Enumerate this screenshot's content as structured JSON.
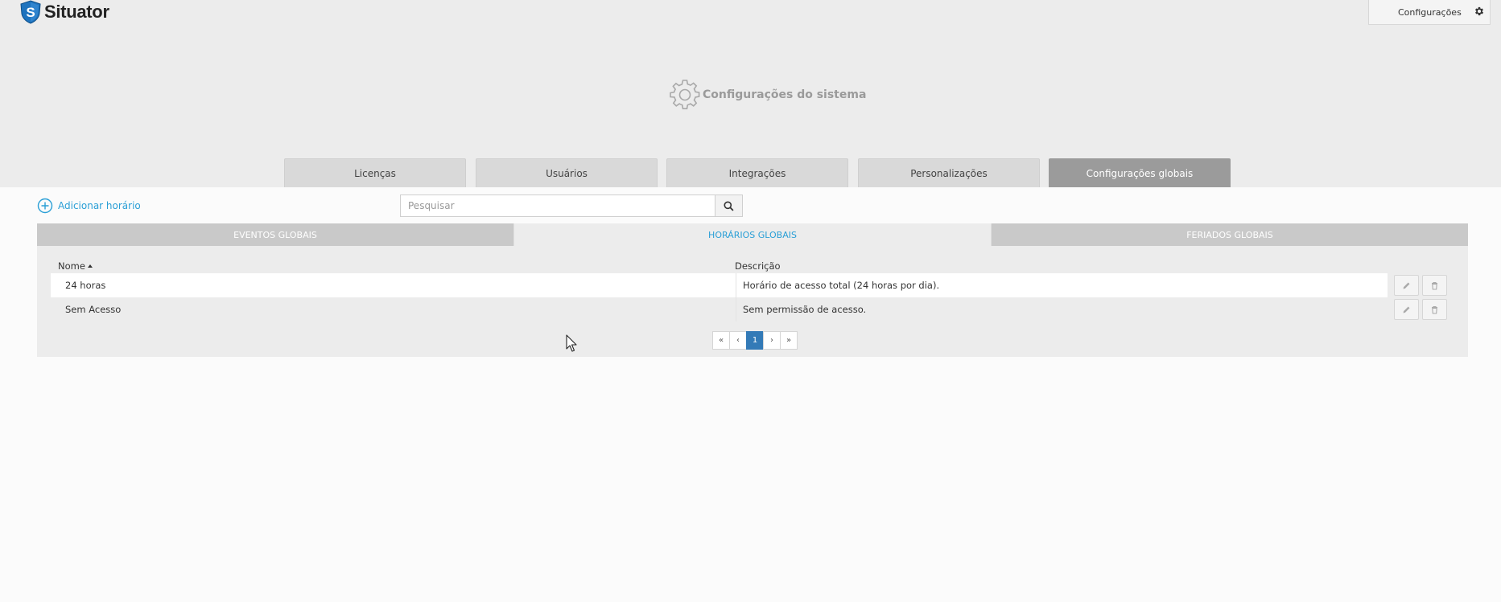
{
  "app": {
    "brand": "Situator"
  },
  "topbar": {
    "config_label": "Configurações",
    "config_icon": "gear-icon"
  },
  "page": {
    "title": "Configurações do sistema",
    "title_icon": "gear-icon"
  },
  "main_tabs": [
    {
      "label": "Licenças",
      "active": false
    },
    {
      "label": "Usuários",
      "active": false
    },
    {
      "label": "Integrações",
      "active": false
    },
    {
      "label": "Personalizações",
      "active": false
    },
    {
      "label": "Configurações globais",
      "active": true
    }
  ],
  "toolbar": {
    "add_label": "Adicionar horário",
    "add_icon": "plus-circle-icon",
    "search_placeholder": "Pesquisar",
    "search_value": "",
    "search_icon": "search-icon"
  },
  "sub_tabs": [
    {
      "label": "EVENTOS GLOBAIS",
      "active": false
    },
    {
      "label": "HORÁRIOS GLOBAIS",
      "active": true
    },
    {
      "label": "FERIADOS GLOBAIS",
      "active": false
    }
  ],
  "table": {
    "columns": [
      "Nome",
      "Descrição"
    ],
    "sort_column": "Nome",
    "sort_direction": "asc",
    "rows": [
      {
        "name": "24 horas",
        "description": "Horário de acesso total (24 horas por dia)."
      },
      {
        "name": "Sem Acesso",
        "description": "Sem permissão de acesso."
      }
    ],
    "row_actions": [
      "pencil-icon",
      "trash-icon"
    ]
  },
  "pagination": {
    "first": "«",
    "prev": "‹",
    "current": "1",
    "next": "›",
    "last": "»"
  },
  "colors": {
    "accent": "#2a9fd6",
    "active_tab": "#9b9b9b",
    "pager_active": "#337ab7",
    "logo_blue": "#1e73be"
  }
}
